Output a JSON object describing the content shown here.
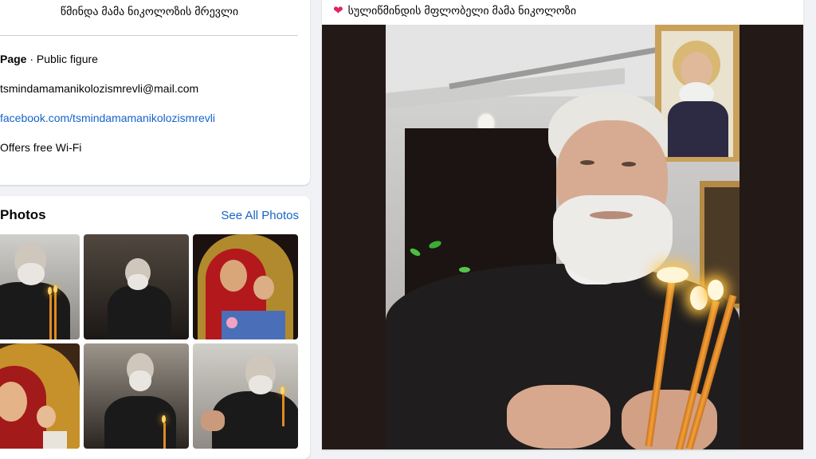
{
  "intro": {
    "bio": "წმინდა მამა ნიკოლოზის მრევლი",
    "page_type_bold": "Page",
    "page_type_rest": " · Public figure",
    "email": "tsmindamamanikolozismrevli@mail.com",
    "website": "facebook.com/tsmindamamanikolozismrevli",
    "wifi": "Offers free Wi-Fi"
  },
  "photos": {
    "title": "Photos",
    "see_all": "See All Photos"
  },
  "post": {
    "title": "სულიწმინდის მფლობელი მამა ნიკოლოზი"
  },
  "colors": {
    "link": "#1664c9",
    "heart": "#e0245e",
    "background": "#f0f2f5"
  }
}
